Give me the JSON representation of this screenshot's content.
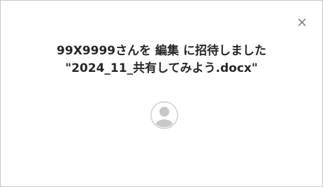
{
  "dialog": {
    "close_icon": "close-icon",
    "message_line1": "99X9999さんを 編集 に招待しました",
    "message_line2": "\"2024_11_共有してみよう.docx\"",
    "avatar_icon": "person-icon"
  },
  "colors": {
    "border": "#c6c6c6",
    "text": "#262626",
    "avatar_ring": "#d0d0d0",
    "avatar_fill": "#c8c8c8"
  }
}
